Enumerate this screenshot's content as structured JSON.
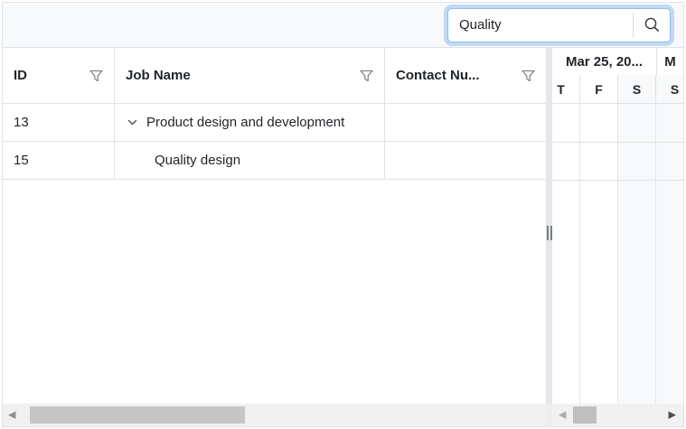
{
  "toolbar": {
    "search": {
      "value": "Quality",
      "icon": "magnifier"
    }
  },
  "grid": {
    "columns": [
      {
        "label": "ID"
      },
      {
        "label": "Job Name"
      },
      {
        "label": "Contact Nu..."
      }
    ],
    "rows": [
      {
        "id": "13",
        "job_name": "Product design and development",
        "contact": "",
        "expanded": true
      },
      {
        "id": "15",
        "job_name": "Quality design",
        "contact": "",
        "child": true
      }
    ]
  },
  "timeline": {
    "top_tier": [
      {
        "label": "Mar 25, 20..."
      },
      {
        "label": "M"
      }
    ],
    "day_tier": [
      "T",
      "F",
      "S",
      "S"
    ],
    "weekend_columns": [
      2,
      3
    ]
  },
  "colors": {
    "border": "#dee2e6",
    "toolbar_bg": "#f8f9fa",
    "weekend_bg": "#f8f9fa",
    "text": "#212529",
    "focus_ring": "#c2d9f4",
    "splitter": "#e4e7eb",
    "scroll_track": "#f1f1f1",
    "scroll_thumb": "#c6c6c6"
  }
}
